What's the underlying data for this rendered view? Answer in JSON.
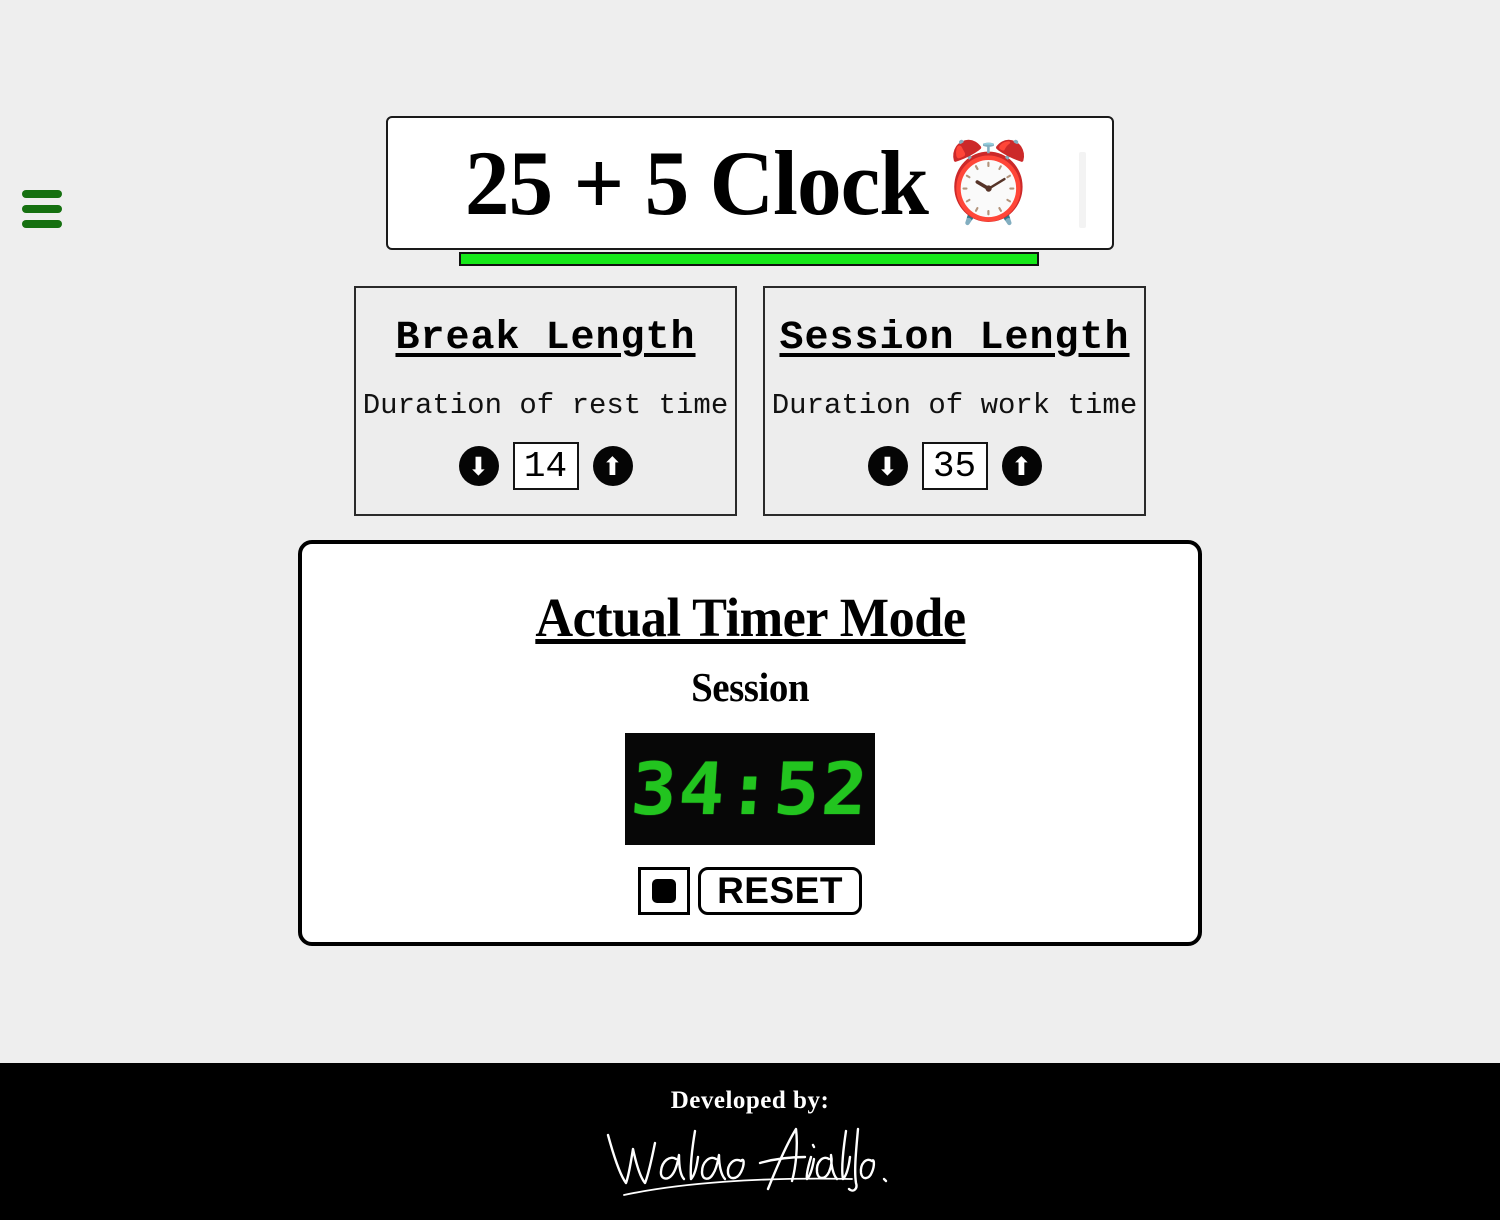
{
  "page": {
    "background_color": "#eeeeee",
    "accent_green": "#16e819",
    "menu_green": "#157010",
    "lcd_green": "#22c41f"
  },
  "menu": {
    "icon": "hamburger-icon",
    "label": "Menu"
  },
  "header": {
    "title": "25 + 5 Clock",
    "emoji": "⏰",
    "emoji_name": "alarm-clock-icon"
  },
  "break_panel": {
    "title": "Break Length",
    "description": "Duration of rest time",
    "value": "14",
    "decrement_icon": "⬇",
    "increment_icon": "⬆"
  },
  "session_panel": {
    "title": "Session Length",
    "description": "Duration of work time",
    "value": "35",
    "decrement_icon": "⬇",
    "increment_icon": "⬆"
  },
  "timer": {
    "title": "Actual Timer Mode",
    "mode": "Session",
    "display": "34:52",
    "stop_icon": "⏹",
    "reset_label": "RESET"
  },
  "footer": {
    "developed_by": "Developed by:",
    "author": "Waldo Hidalgo"
  }
}
